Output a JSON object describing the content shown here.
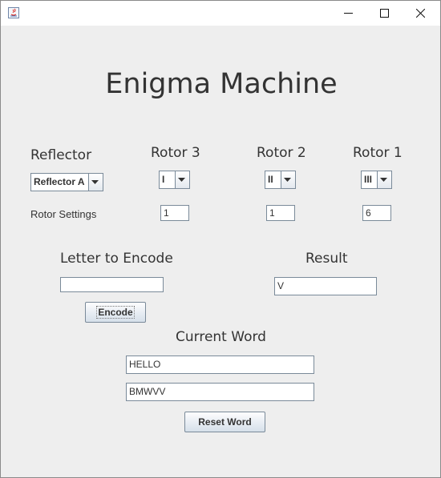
{
  "title": "Enigma Machine",
  "reflector": {
    "label": "Reflector",
    "selected": "Reflector A"
  },
  "rotors": [
    {
      "label": "Rotor 3",
      "selected": "I",
      "setting": "1"
    },
    {
      "label": "Rotor 2",
      "selected": "II",
      "setting": "1"
    },
    {
      "label": "Rotor 1",
      "selected": "III",
      "setting": "6"
    }
  ],
  "rotor_settings_label": "Rotor Settings",
  "encode_section": {
    "label": "Letter to Encode",
    "value": "",
    "button": "Encode"
  },
  "result_section": {
    "label": "Result",
    "value": "V"
  },
  "current_word": {
    "label": "Current Word",
    "plain": "HELLO",
    "encoded": "BMWVV",
    "reset_button": "Reset Word"
  },
  "icons": {
    "app": "java-app-icon",
    "minimize": "minimize-icon",
    "maximize": "maximize-icon",
    "close": "close-icon",
    "dropdown": "chevron-down-icon"
  }
}
